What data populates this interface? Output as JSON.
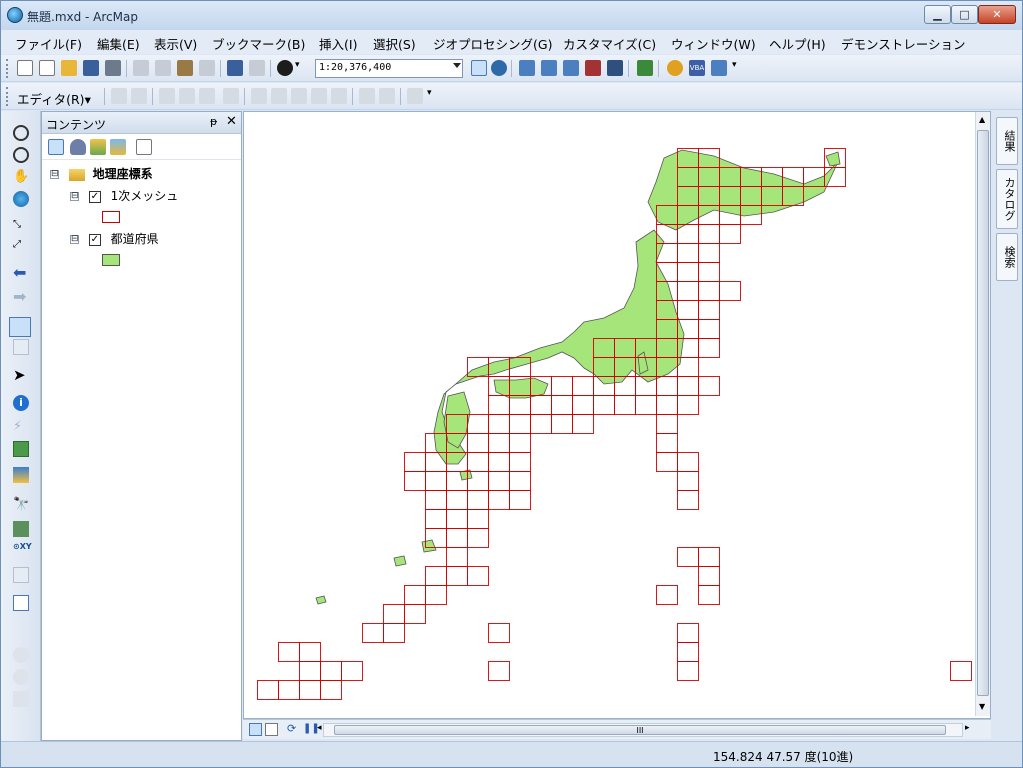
{
  "window": {
    "title": "無題.mxd - ArcMap",
    "min_label": "▁",
    "max_label": "□",
    "close_label": "✕"
  },
  "menu": [
    "ファイル(F)",
    "編集(E)",
    "表示(V)",
    "ブックマーク(B)",
    "挿入(I)",
    "選択(S)",
    "ジオプロセシング(G)",
    "カスタマイズ(C)",
    "ウィンドウ(W)",
    "ヘルプ(H)",
    "デモンストレーション"
  ],
  "toolbar": {
    "scale": "1:20,376,400",
    "editor_menu": "エディタ(R)▾"
  },
  "toc": {
    "title": "コンテンツ",
    "pin": "ᵽ",
    "close": "✕",
    "root": {
      "expander": "⊟",
      "label": "地理座標系"
    },
    "layers": [
      {
        "expander": "⊟",
        "checked": "✓",
        "label": "1次メッシュ"
      },
      {
        "expander": "⊟",
        "checked": "✓",
        "label": "都道府県"
      }
    ]
  },
  "right_tabs": [
    "結果",
    "カタログ",
    "検索"
  ],
  "status": {
    "coordinates": "154.824  47.57 度(10進)"
  },
  "map": {
    "mesh_color": "#d40000",
    "land_color": "#a6e57a",
    "border_color": "#555555"
  },
  "hscroll_label": "III"
}
